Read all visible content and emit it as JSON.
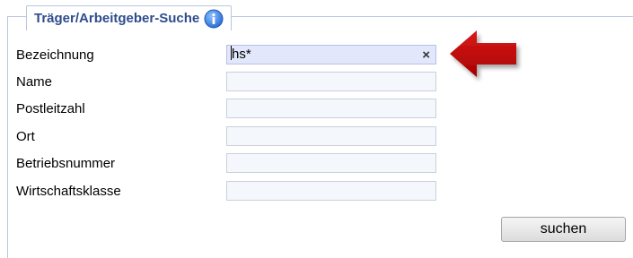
{
  "panel": {
    "title": "Träger/Arbeitgeber-Suche",
    "info_icon": "info-icon",
    "accent_color": "#2e4c8c"
  },
  "fields": [
    {
      "label": "Bezeichnung",
      "value": "hs*",
      "placeholder": ""
    },
    {
      "label": "Name",
      "value": "",
      "placeholder": ""
    },
    {
      "label": "Postleitzahl",
      "value": "",
      "placeholder": ""
    },
    {
      "label": "Ort",
      "value": "",
      "placeholder": ""
    },
    {
      "label": "Betriebsnummer",
      "value": "",
      "placeholder": ""
    },
    {
      "label": "Wirtschaftsklasse",
      "value": "",
      "placeholder": ""
    }
  ],
  "clear_icon": "×",
  "annotation": {
    "icon": "red-arrow-icon",
    "color": "#c00000"
  },
  "search_button": {
    "label": "suchen"
  }
}
